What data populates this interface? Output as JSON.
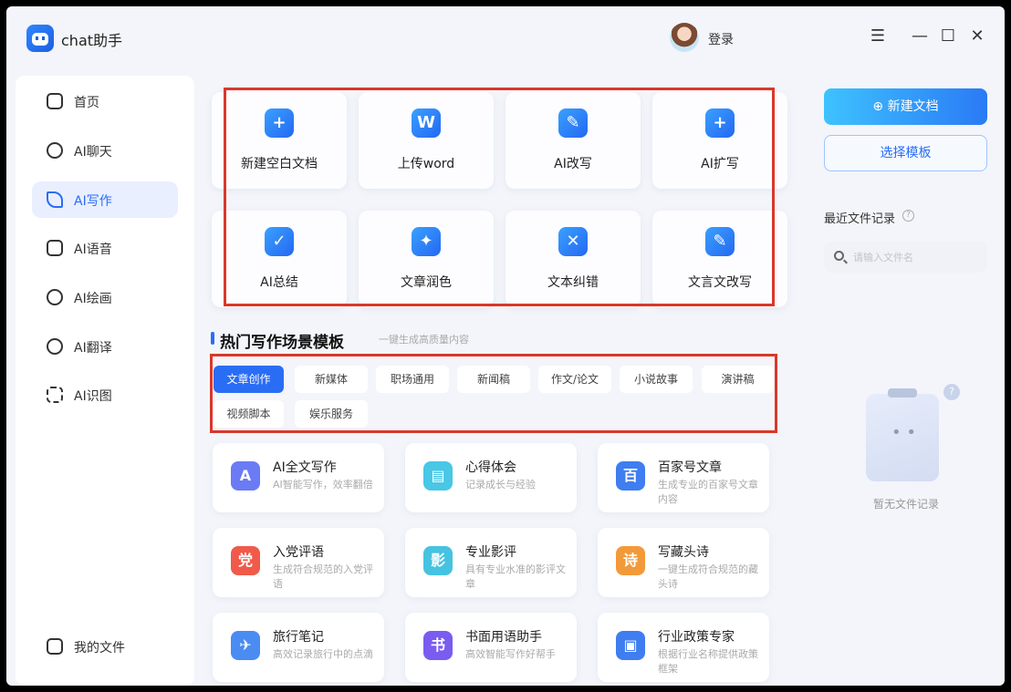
{
  "app": {
    "title": "chat助手",
    "login": "登录"
  },
  "window_controls": {
    "menu": "☰",
    "minimize": "—",
    "maximize": "☐",
    "close": "✕"
  },
  "sidebar": {
    "items": [
      {
        "label": "首页",
        "icon": "home-icon"
      },
      {
        "label": "AI聊天",
        "icon": "chat-icon"
      },
      {
        "label": "AI写作",
        "icon": "pen-icon",
        "active": true
      },
      {
        "label": "AI语音",
        "icon": "voice-icon"
      },
      {
        "label": "AI绘画",
        "icon": "palette-icon"
      },
      {
        "label": "AI翻译",
        "icon": "translate-icon"
      },
      {
        "label": "AI识图",
        "icon": "scan-icon"
      }
    ],
    "footer": {
      "label": "我的文件",
      "icon": "file-icon"
    }
  },
  "tools": [
    {
      "label": "新建空白文档",
      "icon": "plus-doc-icon",
      "glyph": "+"
    },
    {
      "label": "上传word",
      "icon": "word-icon",
      "glyph": "W"
    },
    {
      "label": "AI改写",
      "icon": "rewrite-icon",
      "glyph": "✎"
    },
    {
      "label": "AI扩写",
      "icon": "expand-icon",
      "glyph": "+"
    },
    {
      "label": "AI总结",
      "icon": "summary-icon",
      "glyph": "✓"
    },
    {
      "label": "文章润色",
      "icon": "polish-icon",
      "glyph": "✦"
    },
    {
      "label": "文本纠错",
      "icon": "correct-icon",
      "glyph": "✕"
    },
    {
      "label": "文言文改写",
      "icon": "classical-icon",
      "glyph": "✎"
    }
  ],
  "section": {
    "title": "热门写作场景模板",
    "subtitle": "一键生成高质量内容"
  },
  "tabs": [
    "文章创作",
    "新媒体",
    "职场通用",
    "新闻稿",
    "作文/论文",
    "小说故事",
    "演讲稿",
    "视频脚本",
    "娱乐服务"
  ],
  "templates": [
    {
      "title": "AI全文写作",
      "desc": "AI智能写作，效率翻倍",
      "glyph": "A",
      "color": "#6a7bf5"
    },
    {
      "title": "心得体会",
      "desc": "记录成长与经验",
      "glyph": "▤",
      "color": "#48c7e6"
    },
    {
      "title": "百家号文章",
      "desc": "生成专业的百家号文章内容",
      "glyph": "百",
      "color": "#3f7df0"
    },
    {
      "title": "入党评语",
      "desc": "生成符合规范的入党评语",
      "glyph": "党",
      "color": "#f05a4a"
    },
    {
      "title": "专业影评",
      "desc": "具有专业水准的影评文章",
      "glyph": "影",
      "color": "#46c3e0"
    },
    {
      "title": "写藏头诗",
      "desc": "一键生成符合规范的藏头诗",
      "glyph": "诗",
      "color": "#f29a3a"
    },
    {
      "title": "旅行笔记",
      "desc": "高效记录旅行中的点滴",
      "glyph": "✈",
      "color": "#4a8cf2"
    },
    {
      "title": "书面用语助手",
      "desc": "高效智能写作好帮手",
      "glyph": "书",
      "color": "#7a5cf0"
    },
    {
      "title": "行业政策专家",
      "desc": "根据行业名称提供政策框架",
      "glyph": "▣",
      "color": "#3f7df0"
    }
  ],
  "right_panel": {
    "new_doc": "⊕ 新建文档",
    "choose_template": "选择模板",
    "recent_label": "最近文件记录",
    "search_placeholder": "请输入文件名",
    "empty_text": "暂无文件记录"
  }
}
